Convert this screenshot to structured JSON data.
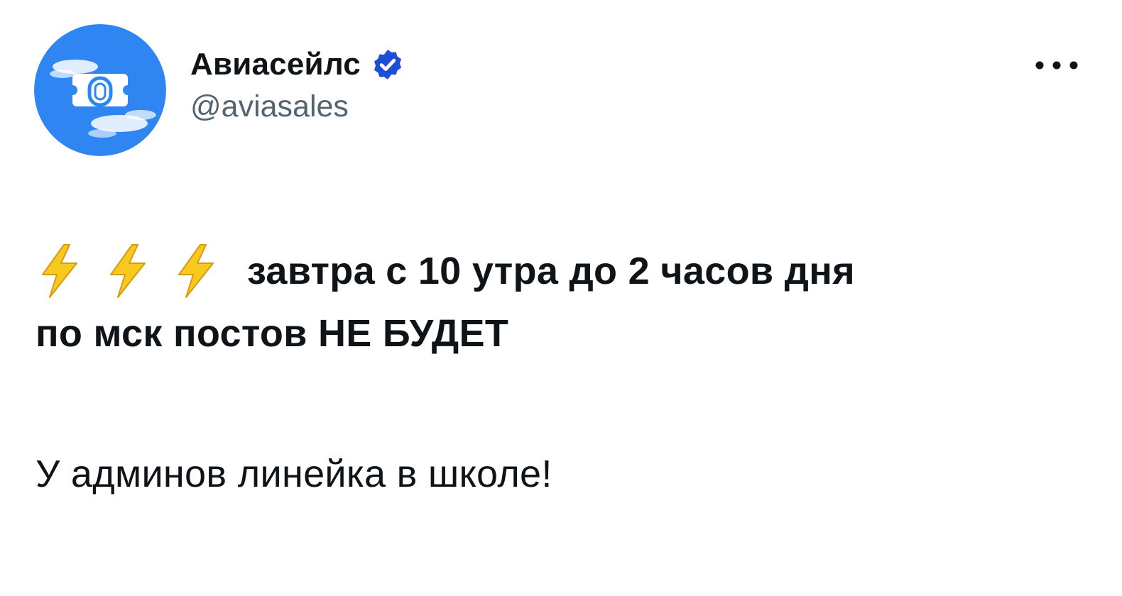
{
  "tweet": {
    "author": {
      "display_name": "Авиасейлс",
      "handle": "@aviasales",
      "verified": true,
      "avatar_icon": "aviasales-logo-icon",
      "verified_icon": "verified-badge-icon"
    },
    "more_icon": "more-options-icon",
    "text": {
      "emoji_icon": "high-voltage-icon",
      "emoji_count": 3,
      "line1": "завтра с 10 утра до 2 часов дня",
      "line2": "по мск постов НЕ БУДЕТ",
      "line3": "У админов линейка в школе!"
    }
  },
  "colors": {
    "background": "#ffffff",
    "text": "#0f1419",
    "secondary_text": "#536471",
    "avatar_blue": "#2b7ff0",
    "verified_badge": "#1d4ed8",
    "bolt_yellow": "#f5c518"
  }
}
